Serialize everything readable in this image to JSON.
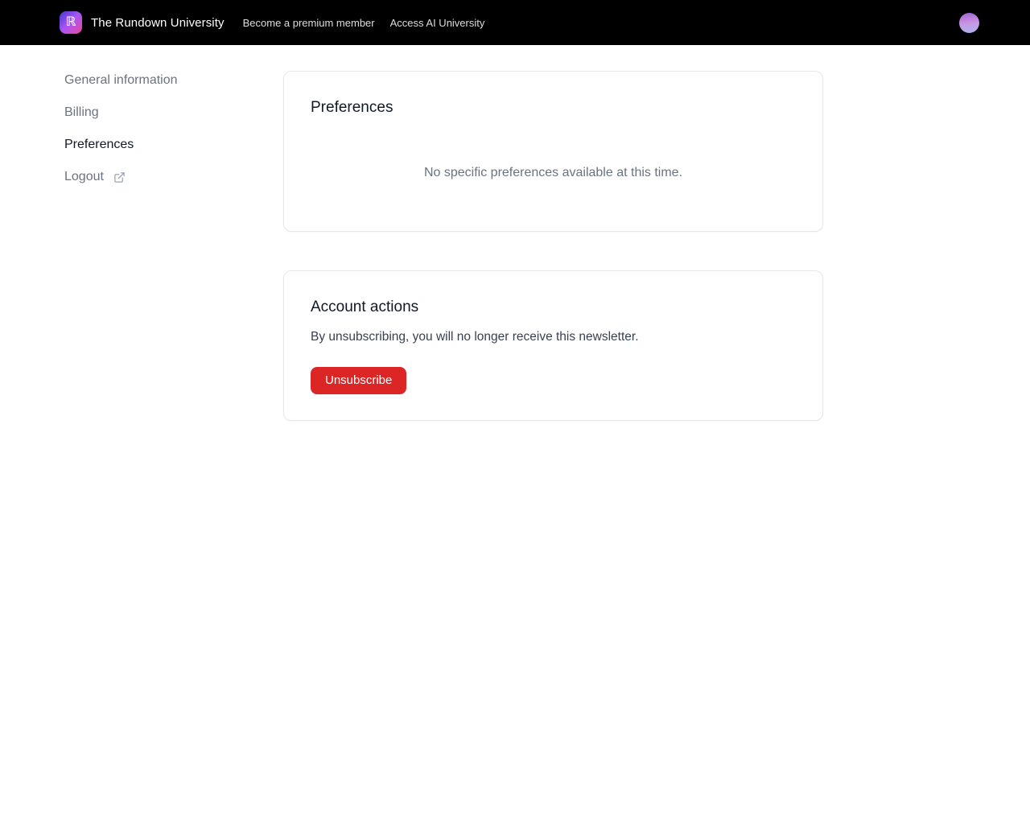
{
  "navbar": {
    "background_color": "#000000",
    "brand": {
      "logo_glyph": "ℝ",
      "logo_gradient": [
        "#4338ca",
        "#a855f7",
        "#ec4899"
      ],
      "title": "The Rundown University"
    },
    "links": [
      {
        "label": "Become a premium member"
      },
      {
        "label": "Access AI University"
      }
    ],
    "avatar": {
      "icon": "user-avatar",
      "gradient": [
        "#9a66d6",
        "#a9b3ef"
      ]
    }
  },
  "sidebar": {
    "items": [
      {
        "label": "General information",
        "active": false
      },
      {
        "label": "Billing",
        "active": false
      },
      {
        "label": "Preferences",
        "active": true
      },
      {
        "label": "Logout",
        "active": false,
        "icon": "external-link-icon"
      }
    ]
  },
  "main": {
    "preferences_card": {
      "title": "Preferences",
      "empty_message": "No specific preferences available at this time."
    },
    "account_card": {
      "title": "Account actions",
      "description": "By unsubscribing, you will no longer receive this newsletter.",
      "unsubscribe_label": "Unsubscribe",
      "button_color": "#dc2626"
    }
  }
}
